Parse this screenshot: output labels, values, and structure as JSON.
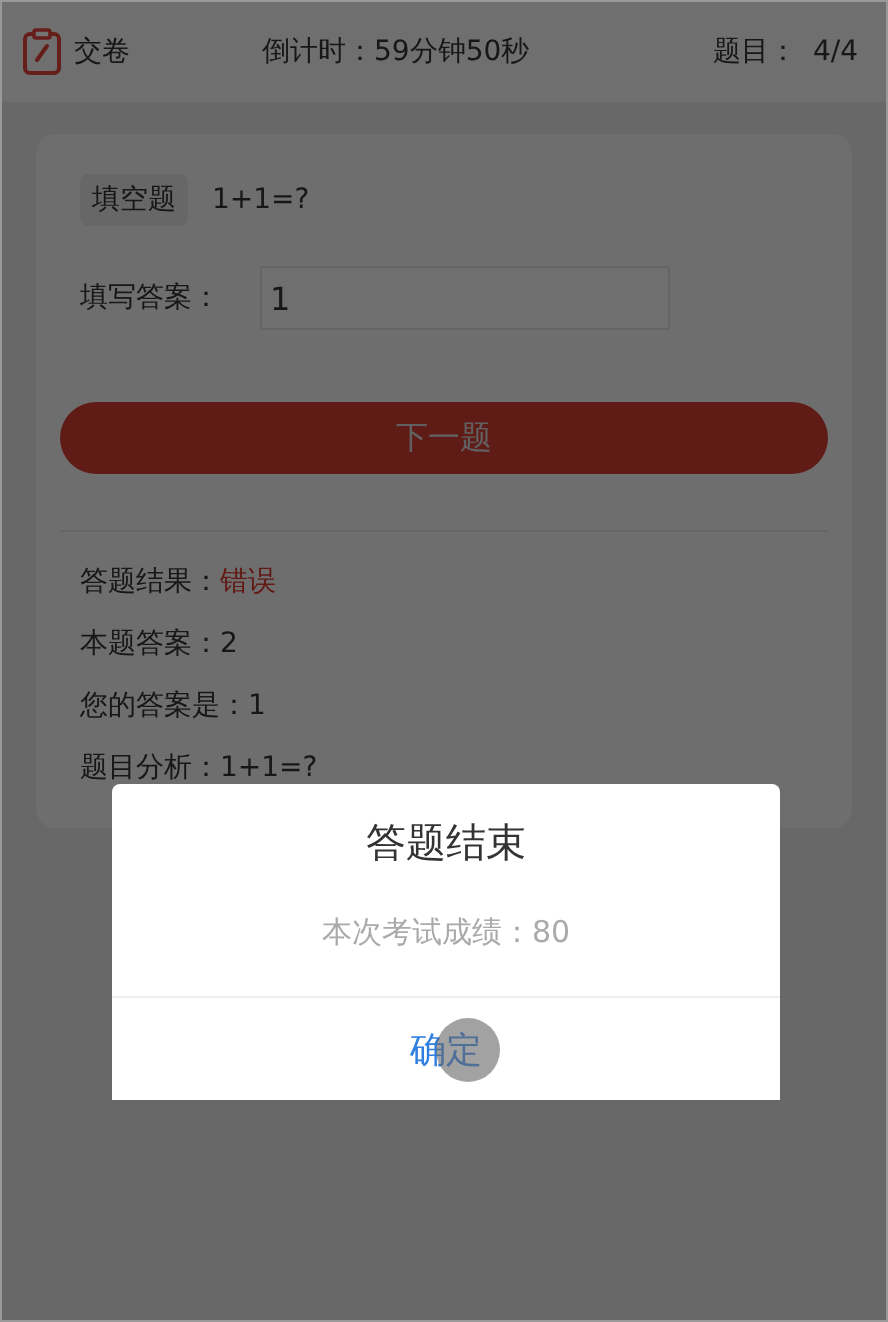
{
  "header": {
    "submit": "交卷",
    "countdown": "倒计时：59分钟50秒",
    "progress_label": "题目：",
    "progress": "4/4"
  },
  "question": {
    "type_tag": "填空题",
    "text": "1+1=?",
    "answer_label": "填写答案：",
    "answer_value": "1"
  },
  "next_button": "下一题",
  "result": [
    {
      "label": "答题结果：",
      "value": "错误",
      "kind": "wrong"
    },
    {
      "label": "本题答案：",
      "value": "2",
      "kind": "plain"
    },
    {
      "label": "您的答案是：",
      "value": "1",
      "kind": "plain"
    },
    {
      "label": "题目分析：",
      "value": "1+1=?",
      "kind": "plain"
    }
  ],
  "dialog": {
    "title": "答题结束",
    "message": "本次考试成绩：80",
    "confirm": "确定"
  }
}
